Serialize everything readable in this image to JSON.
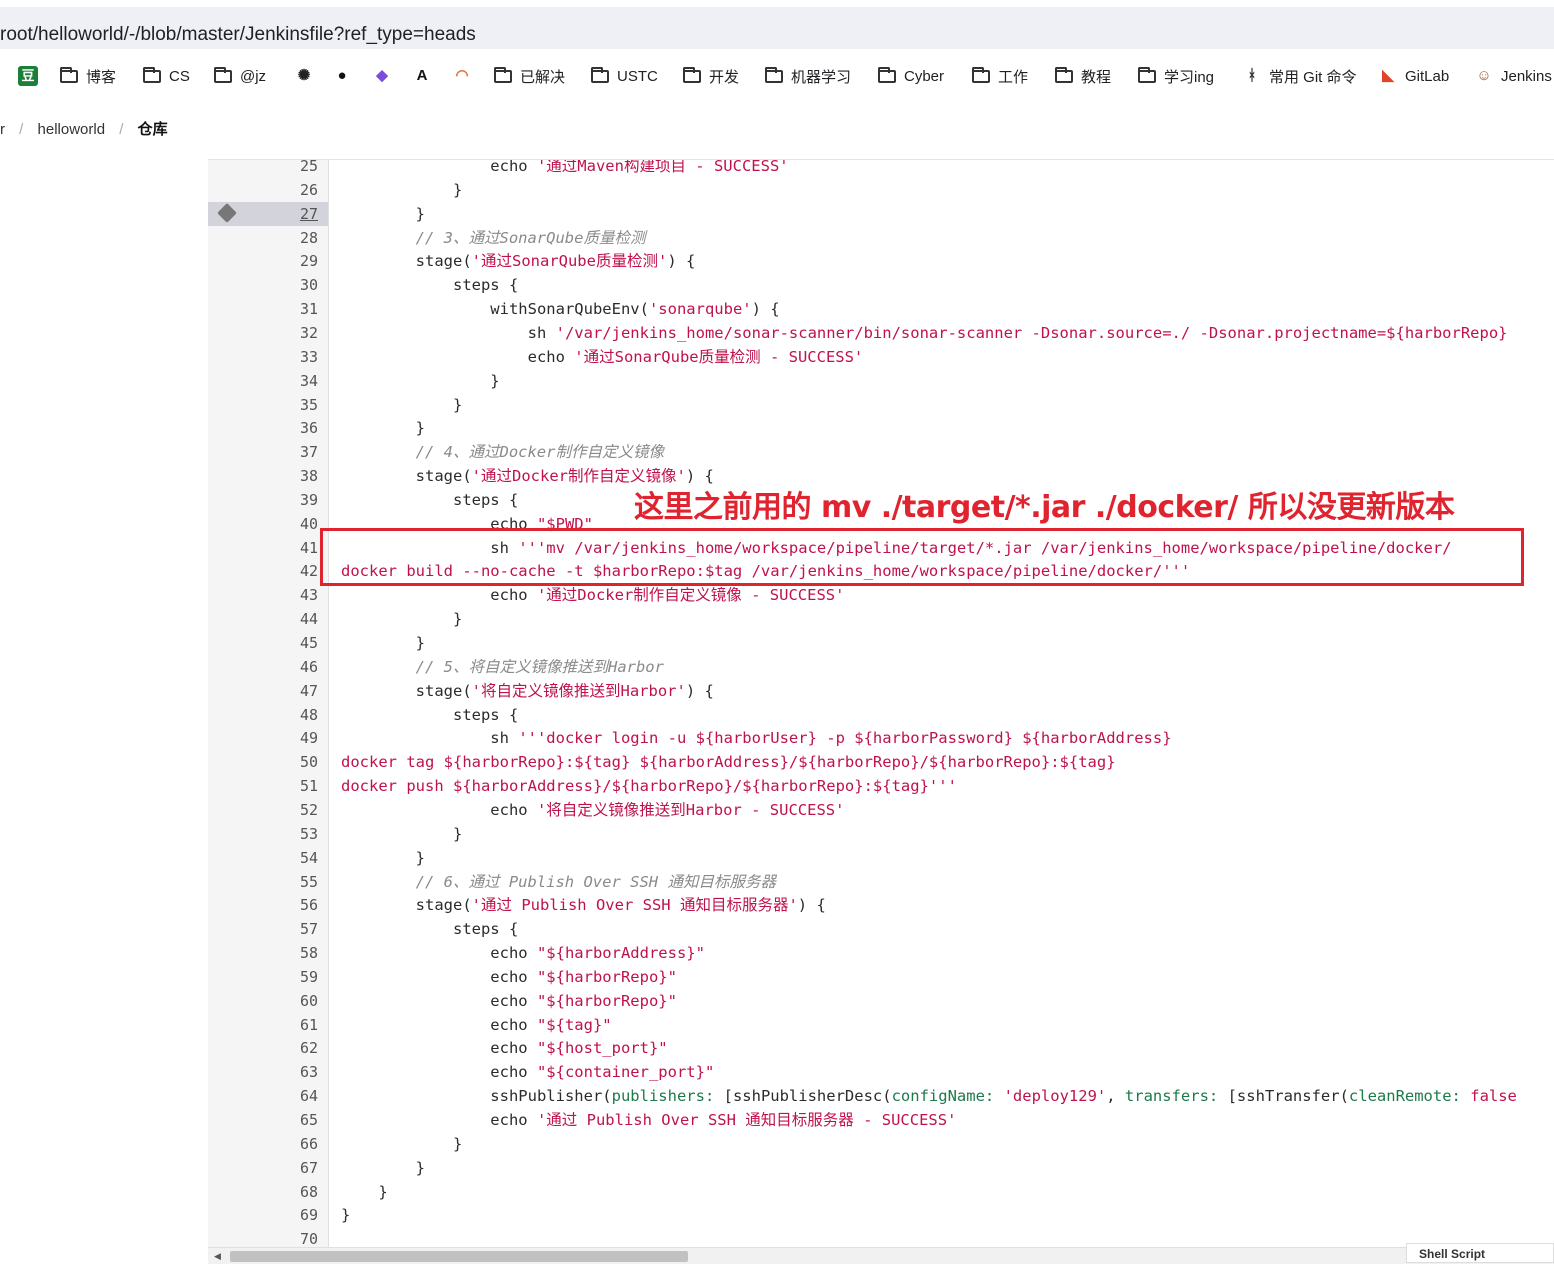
{
  "browser": {
    "url": "root/helloworld/-/blob/master/Jenkinsfile?ref_type=heads",
    "bookmarks": [
      {
        "label": "",
        "icon": "douban-icon"
      },
      {
        "label": "博客",
        "icon": "folder-icon"
      },
      {
        "label": "CS",
        "icon": "folder-icon"
      },
      {
        "label": "@jz",
        "icon": "folder-icon"
      },
      {
        "label": "",
        "icon": "openai-icon"
      },
      {
        "label": "",
        "icon": "github-icon"
      },
      {
        "label": "",
        "icon": "copilot-icon"
      },
      {
        "label": "",
        "icon": "anthropic-icon"
      },
      {
        "label": "",
        "icon": "jupyter-icon"
      },
      {
        "label": "已解决",
        "icon": "folder-icon"
      },
      {
        "label": "USTC",
        "icon": "folder-icon"
      },
      {
        "label": "开发",
        "icon": "folder-icon"
      },
      {
        "label": "机器学习",
        "icon": "folder-icon"
      },
      {
        "label": "Cyber",
        "icon": "folder-icon"
      },
      {
        "label": "工作",
        "icon": "folder-icon"
      },
      {
        "label": "教程",
        "icon": "folder-icon"
      },
      {
        "label": "学习ing",
        "icon": "folder-icon"
      },
      {
        "label": "常用 Git 命令",
        "icon": "git-icon"
      },
      {
        "label": "GitLab",
        "icon": "gitlab-icon"
      },
      {
        "label": "Jenkins",
        "icon": "jenkins-icon"
      }
    ]
  },
  "breadcrumb": {
    "prev": "r",
    "project": "helloworld",
    "current": "仓库"
  },
  "annotation": {
    "text": "这里之前用的 mv ./target/*.jar ./docker/ 所以没更新版本",
    "color": "#e0242f"
  },
  "file": {
    "language": "Shell Script"
  },
  "code": [
    {
      "n": "25",
      "parts": [
        [
          "",
          "                echo "
        ],
        [
          "str",
          "'通过Maven构建项目 - SUCCESS'"
        ]
      ]
    },
    {
      "n": "26",
      "parts": [
        [
          "",
          "            }"
        ]
      ]
    },
    {
      "n": "27",
      "parts": [
        [
          "",
          "        }"
        ]
      ],
      "active": true
    },
    {
      "n": "28",
      "parts": [
        [
          "cmt",
          "        // 3、通过SonarQube质量检测"
        ]
      ]
    },
    {
      "n": "29",
      "parts": [
        [
          "",
          "        stage("
        ],
        [
          "str",
          "'通过SonarQube质量检测'"
        ],
        [
          "",
          ") {"
        ]
      ]
    },
    {
      "n": "30",
      "parts": [
        [
          "",
          "            steps {"
        ]
      ]
    },
    {
      "n": "31",
      "parts": [
        [
          "",
          "                withSonarQubeEnv("
        ],
        [
          "str",
          "'sonarqube'"
        ],
        [
          "",
          ") {"
        ]
      ]
    },
    {
      "n": "32",
      "parts": [
        [
          "",
          "                    sh "
        ],
        [
          "str",
          "'/var/jenkins_home/sonar-scanner/bin/sonar-scanner -Dsonar.source=./ -Dsonar.projectname=${harborRepo} "
        ]
      ]
    },
    {
      "n": "33",
      "parts": [
        [
          "",
          "                    echo "
        ],
        [
          "str",
          "'通过SonarQube质量检测 - SUCCESS'"
        ]
      ]
    },
    {
      "n": "34",
      "parts": [
        [
          "",
          "                }"
        ]
      ]
    },
    {
      "n": "35",
      "parts": [
        [
          "",
          "            }"
        ]
      ]
    },
    {
      "n": "36",
      "parts": [
        [
          "",
          "        }"
        ]
      ]
    },
    {
      "n": "37",
      "parts": [
        [
          "cmt",
          "        // 4、通过Docker制作自定义镜像"
        ]
      ]
    },
    {
      "n": "38",
      "parts": [
        [
          "",
          "        stage("
        ],
        [
          "str",
          "'通过Docker制作自定义镜像'"
        ],
        [
          "",
          ") {"
        ]
      ]
    },
    {
      "n": "39",
      "parts": [
        [
          "",
          "            steps {"
        ]
      ]
    },
    {
      "n": "40",
      "parts": [
        [
          "",
          "                echo "
        ],
        [
          "str",
          "\"$PWD\""
        ]
      ]
    },
    {
      "n": "41",
      "parts": [
        [
          "",
          "                sh "
        ],
        [
          "str",
          "'''mv /var/jenkins_home/workspace/pipeline/target/*.jar /var/jenkins_home/workspace/pipeline/docker/"
        ]
      ]
    },
    {
      "n": "42",
      "parts": [
        [
          "str",
          "docker build --no-cache -t $harborRepo:$tag /var/jenkins_home/workspace/pipeline/docker/'''"
        ]
      ]
    },
    {
      "n": "43",
      "parts": [
        [
          "",
          "                echo "
        ],
        [
          "str",
          "'通过Docker制作自定义镜像 - SUCCESS'"
        ]
      ]
    },
    {
      "n": "44",
      "parts": [
        [
          "",
          "            }"
        ]
      ]
    },
    {
      "n": "45",
      "parts": [
        [
          "",
          "        }"
        ]
      ]
    },
    {
      "n": "46",
      "parts": [
        [
          "cmt",
          "        // 5、将自定义镜像推送到Harbor"
        ]
      ]
    },
    {
      "n": "47",
      "parts": [
        [
          "",
          "        stage("
        ],
        [
          "str",
          "'将自定义镜像推送到Harbor'"
        ],
        [
          "",
          ") {"
        ]
      ]
    },
    {
      "n": "48",
      "parts": [
        [
          "",
          "            steps {"
        ]
      ]
    },
    {
      "n": "49",
      "parts": [
        [
          "",
          "                sh "
        ],
        [
          "str",
          "'''docker login -u ${harborUser} -p ${harborPassword} ${harborAddress}"
        ]
      ]
    },
    {
      "n": "50",
      "parts": [
        [
          "str",
          "docker tag ${harborRepo}:${tag} ${harborAddress}/${harborRepo}/${harborRepo}:${tag}"
        ]
      ]
    },
    {
      "n": "51",
      "parts": [
        [
          "str",
          "docker push ${harborAddress}/${harborRepo}/${harborRepo}:${tag}'''"
        ]
      ]
    },
    {
      "n": "52",
      "parts": [
        [
          "",
          "                echo "
        ],
        [
          "str",
          "'将自定义镜像推送到Harbor - SUCCESS'"
        ]
      ]
    },
    {
      "n": "53",
      "parts": [
        [
          "",
          "            }"
        ]
      ]
    },
    {
      "n": "54",
      "parts": [
        [
          "",
          "        }"
        ]
      ]
    },
    {
      "n": "55",
      "parts": [
        [
          "cmt",
          "        // 6、通过 Publish Over SSH 通知目标服务器"
        ]
      ]
    },
    {
      "n": "56",
      "parts": [
        [
          "",
          "        stage("
        ],
        [
          "str",
          "'通过 Publish Over SSH 通知目标服务器'"
        ],
        [
          "",
          ") {"
        ]
      ]
    },
    {
      "n": "57",
      "parts": [
        [
          "",
          "            steps {"
        ]
      ]
    },
    {
      "n": "58",
      "parts": [
        [
          "",
          "                echo "
        ],
        [
          "str",
          "\"${harborAddress}\""
        ]
      ]
    },
    {
      "n": "59",
      "parts": [
        [
          "",
          "                echo "
        ],
        [
          "str",
          "\"${harborRepo}\""
        ]
      ]
    },
    {
      "n": "60",
      "parts": [
        [
          "",
          "                echo "
        ],
        [
          "str",
          "\"${harborRepo}\""
        ]
      ]
    },
    {
      "n": "61",
      "parts": [
        [
          "",
          "                echo "
        ],
        [
          "str",
          "\"${tag}\""
        ]
      ]
    },
    {
      "n": "62",
      "parts": [
        [
          "",
          "                echo "
        ],
        [
          "str",
          "\"${host_port}\""
        ]
      ]
    },
    {
      "n": "63",
      "parts": [
        [
          "",
          "                echo "
        ],
        [
          "str",
          "\"${container_port}\""
        ]
      ]
    },
    {
      "n": "64",
      "parts": [
        [
          "",
          "                sshPublisher("
        ],
        [
          "arg",
          "publishers:"
        ],
        [
          "",
          " [sshPublisherDesc("
        ],
        [
          "arg",
          "configName:"
        ],
        [
          "",
          " "
        ],
        [
          "str",
          "'deploy129'"
        ],
        [
          "",
          ", "
        ],
        [
          "arg",
          "transfers:"
        ],
        [
          "",
          " [sshTransfer("
        ],
        [
          "arg",
          "cleanRemote:"
        ],
        [
          "",
          " "
        ],
        [
          "str",
          "false"
        ]
      ]
    },
    {
      "n": "65",
      "parts": [
        [
          "",
          "                echo "
        ],
        [
          "str",
          "'通过 Publish Over SSH 通知目标服务器 - SUCCESS'"
        ]
      ]
    },
    {
      "n": "66",
      "parts": [
        [
          "",
          "            }"
        ]
      ]
    },
    {
      "n": "67",
      "parts": [
        [
          "",
          "        }"
        ]
      ]
    },
    {
      "n": "68",
      "parts": [
        [
          "",
          "    }"
        ]
      ]
    },
    {
      "n": "69",
      "parts": [
        [
          "",
          "}"
        ]
      ]
    },
    {
      "n": "70",
      "parts": [
        [
          "",
          ""
        ]
      ]
    }
  ]
}
